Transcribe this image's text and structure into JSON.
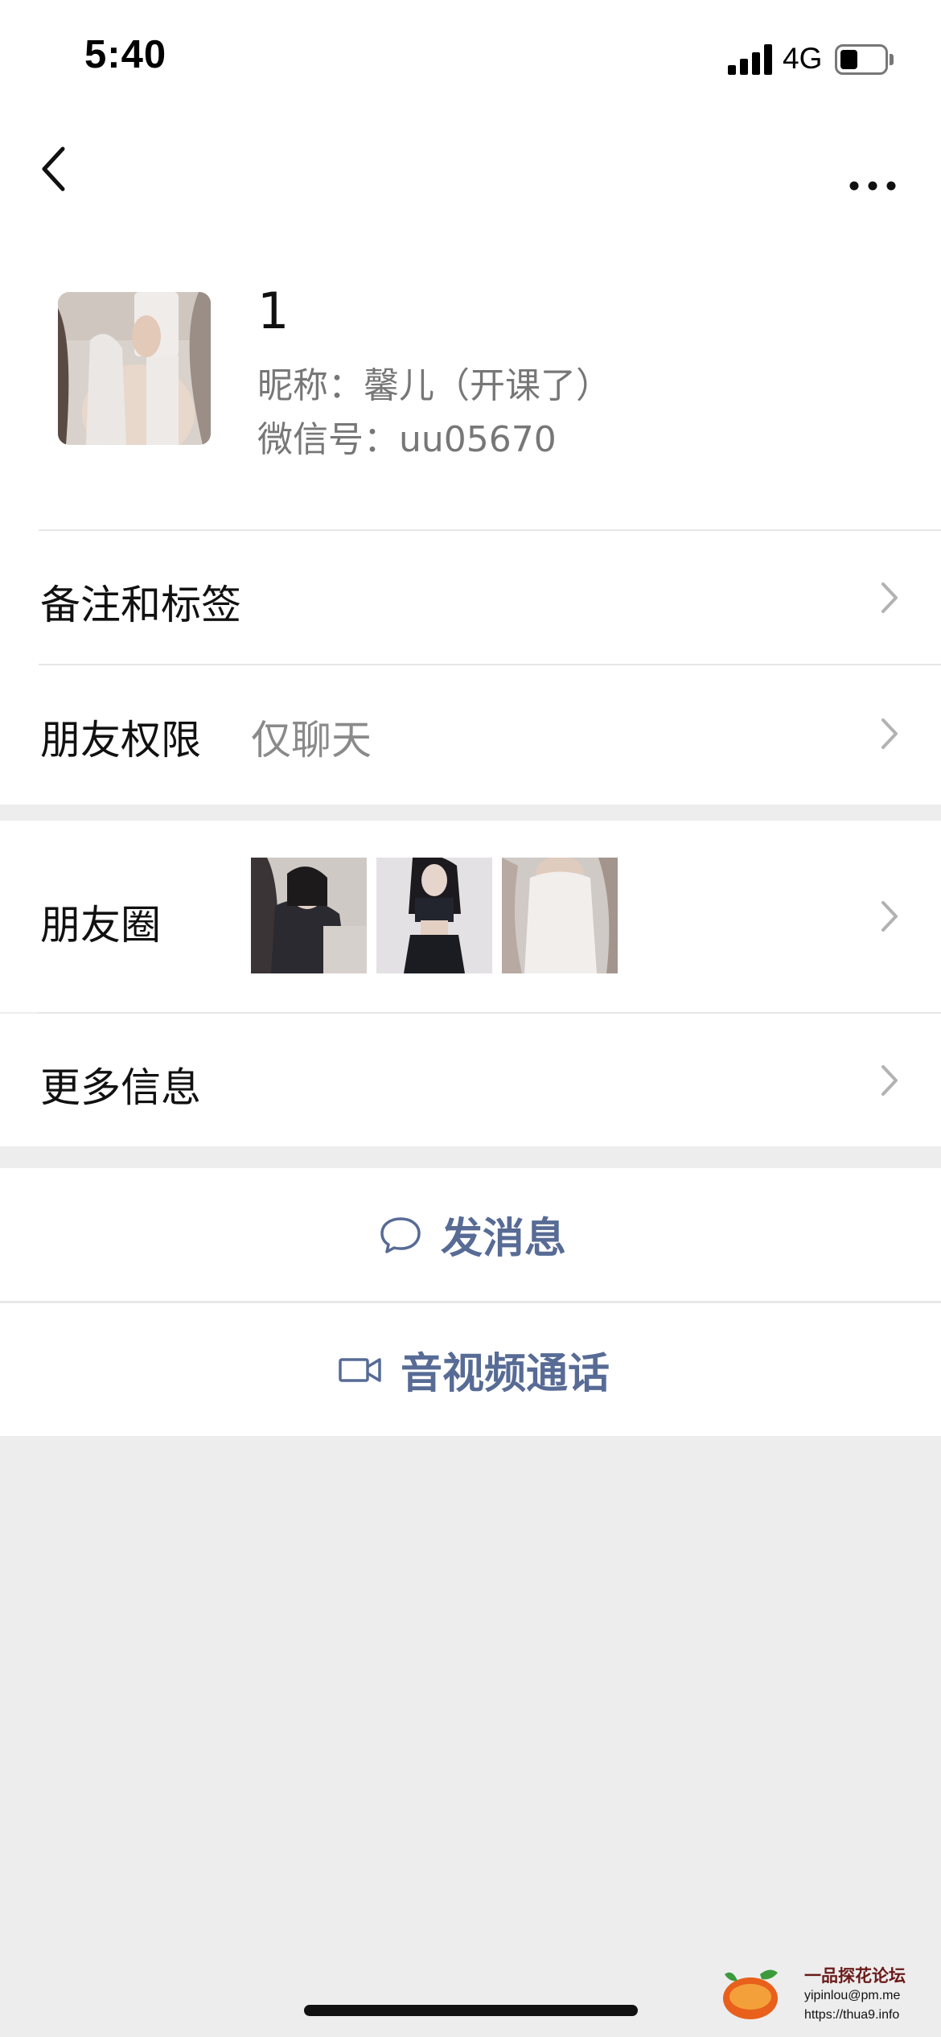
{
  "status_bar": {
    "time": "5:40",
    "network": "4G",
    "battery_level": 0.4
  },
  "nav": {
    "back_icon": "chevron-left-icon",
    "more_icon": "more-dots-icon"
  },
  "profile": {
    "remark_name": "1",
    "nickname": "昵称：馨儿（开课了）",
    "wechat_id": "微信号：uu05670"
  },
  "rows": {
    "remark_tags": {
      "label": "备注和标签"
    },
    "friend_permission": {
      "label": "朋友权限",
      "value": "仅聊天"
    },
    "moments": {
      "label": "朋友圈",
      "thumbnail_count": 3
    },
    "more_info": {
      "label": "更多信息"
    }
  },
  "actions": {
    "send_message": {
      "label": "发消息",
      "icon": "chat-bubble-icon"
    },
    "video_call": {
      "label": "音视频通话",
      "icon": "video-camera-icon"
    }
  },
  "watermark": {
    "title": "一品探花论坛",
    "email": "yipinlou@pm.me",
    "url": "https://thua9.info"
  },
  "colors": {
    "page_background": "#ededed",
    "card_background": "#ffffff",
    "link_blue": "#576b95",
    "secondary_text": "#777777"
  }
}
